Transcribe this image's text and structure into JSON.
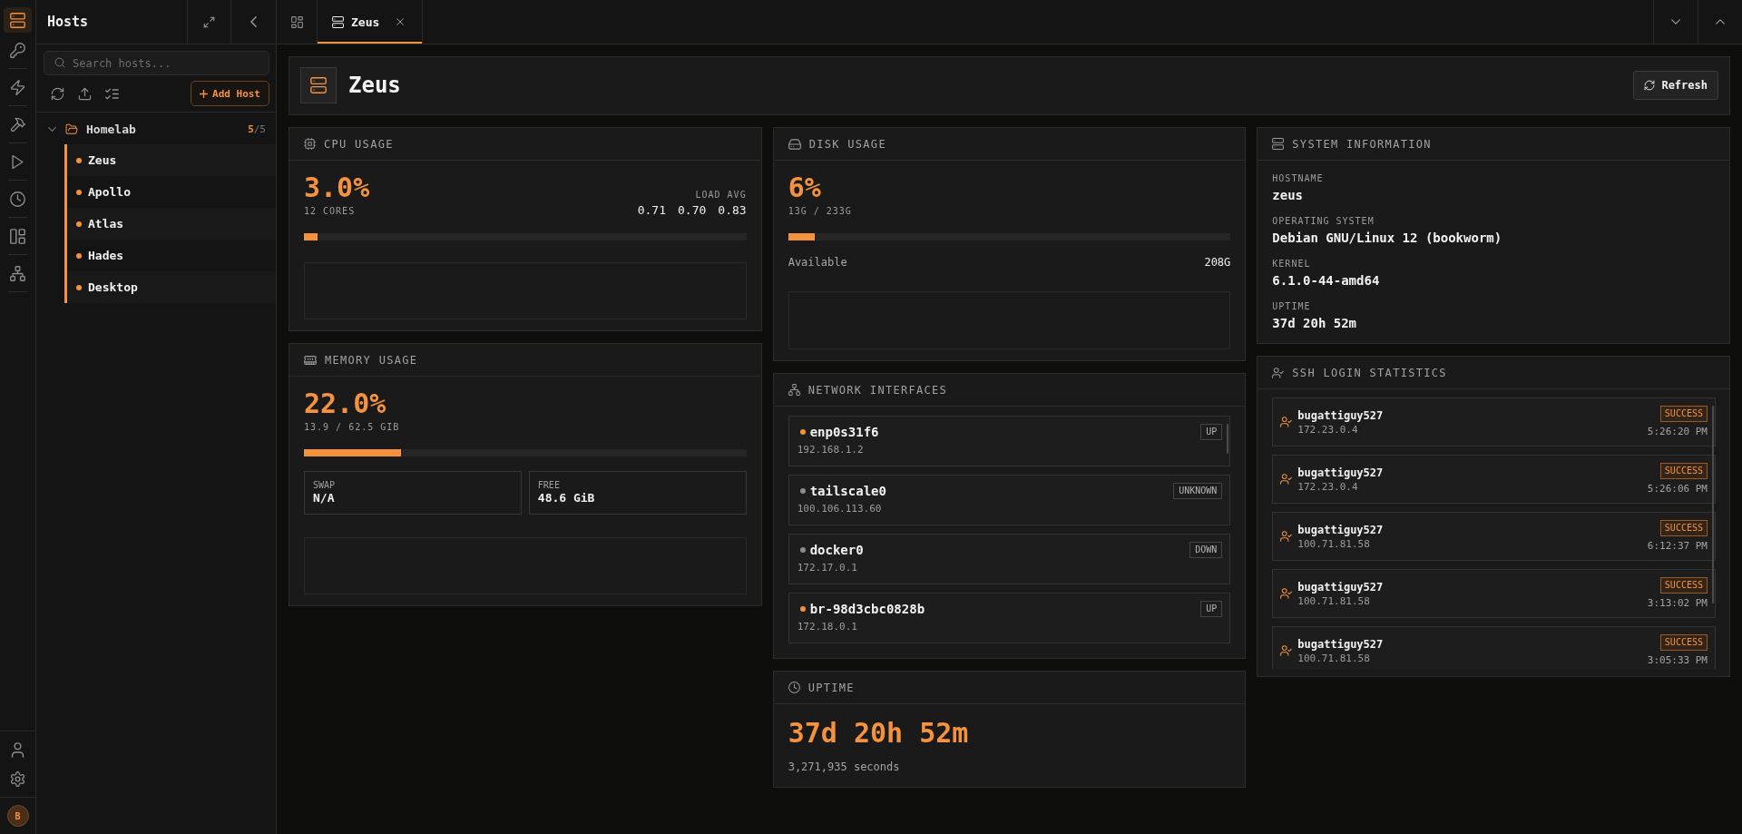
{
  "rail": {
    "groups": [
      {
        "items": [
          {
            "selected": true
          },
          {
            "selected": false
          }
        ]
      },
      {
        "items": [
          {
            "selected": false
          }
        ]
      },
      {
        "items": [
          {
            "selected": false
          }
        ]
      },
      {
        "items": [
          {
            "selected": false
          }
        ]
      },
      {
        "items": [
          {
            "selected": false
          }
        ]
      },
      {
        "items": [
          {
            "selected": false
          }
        ]
      },
      {
        "items": [
          {
            "selected": false
          }
        ]
      }
    ],
    "bottom_items": [
      {
        "selected": false
      },
      {
        "selected": false
      }
    ],
    "avatar": {
      "initial": "B"
    }
  },
  "hosts_panel": {
    "title": "Hosts",
    "search": {
      "placeholder": "Search hosts..."
    },
    "add_button": "Add Host",
    "folders": [
      {
        "name": "Homelab",
        "expanded": true,
        "online": "5",
        "total": "/5",
        "hosts": [
          {
            "name": "Zeus",
            "color": "#f5923e"
          },
          {
            "name": "Apollo",
            "color": "#f5923e"
          },
          {
            "name": "Atlas",
            "color": "#f5923e"
          },
          {
            "name": "Hades",
            "color": "#f5923e"
          },
          {
            "name": "Desktop",
            "color": "#f5923e"
          }
        ]
      }
    ]
  },
  "tabs": [
    {
      "kind": "overview",
      "selected": false
    },
    {
      "kind": "host",
      "label": "Zeus",
      "selected": true,
      "closable": true
    }
  ],
  "header": {
    "title": "Zeus",
    "refresh_button": "Refresh"
  },
  "cpu": {
    "title": "CPU USAGE",
    "value": "3.0%",
    "detail": "12 CORES",
    "load_label": "LOAD AVG",
    "load": [
      "0.71",
      "0.70",
      "0.83"
    ],
    "level": 0.03
  },
  "memory": {
    "title": "MEMORY USAGE",
    "value": "22.0%",
    "detail": "13.9 / 62.5 GIB",
    "level": 0.22,
    "stats": [
      {
        "label": "SWAP",
        "value": "N/A"
      },
      {
        "label": "FREE",
        "value": "48.6 GiB"
      }
    ]
  },
  "disk": {
    "title": "DISK USAGE",
    "value": "6%",
    "detail": "13G / 233G",
    "level": 0.06,
    "available_label": "Available",
    "available": "208G"
  },
  "network": {
    "title": "NETWORK INTERFACES",
    "interfaces": [
      {
        "name": "enp0s31f6",
        "address": "192.168.1.2",
        "status": "UP",
        "color": "#f5923e"
      },
      {
        "name": "tailscale0",
        "address": "100.106.113.60",
        "status": "UNKNOWN",
        "color": "#8c8c8c"
      },
      {
        "name": "docker0",
        "address": "172.17.0.1",
        "status": "DOWN",
        "color": "#8c8c8c"
      },
      {
        "name": "br-98d3cbc0828b",
        "address": "172.18.0.1",
        "status": "UP",
        "color": "#f5923e"
      }
    ]
  },
  "uptime": {
    "title": "UPTIME",
    "value": "37d 20h 52m",
    "seconds": "3,271,935 seconds"
  },
  "system_info": {
    "title": "SYSTEM INFORMATION",
    "fields": [
      {
        "label": "HOSTNAME",
        "value": "zeus"
      },
      {
        "label": "OPERATING SYSTEM",
        "value": "Debian GNU/Linux 12 (bookworm)"
      },
      {
        "label": "KERNEL",
        "value": "6.1.0-44-amd64"
      },
      {
        "label": "UPTIME",
        "value": "37d 20h 52m"
      }
    ]
  },
  "ssh_logins": {
    "title": "SSH LOGIN STATISTICS",
    "logins": [
      {
        "user": "bugattiguy527",
        "ip": "172.23.0.4",
        "result": "SUCCESS",
        "success": true,
        "time": "5:26:20 PM"
      },
      {
        "user": "bugattiguy527",
        "ip": "172.23.0.4",
        "result": "SUCCESS",
        "success": true,
        "time": "5:26:06 PM"
      },
      {
        "user": "bugattiguy527",
        "ip": "100.71.81.58",
        "result": "SUCCESS",
        "success": true,
        "time": "6:12:37 PM"
      },
      {
        "user": "bugattiguy527",
        "ip": "100.71.81.58",
        "result": "SUCCESS",
        "success": true,
        "time": "3:13:02 PM"
      },
      {
        "user": "bugattiguy527",
        "ip": "100.71.81.58",
        "result": "SUCCESS",
        "success": true,
        "time": "3:05:33 PM"
      }
    ]
  }
}
